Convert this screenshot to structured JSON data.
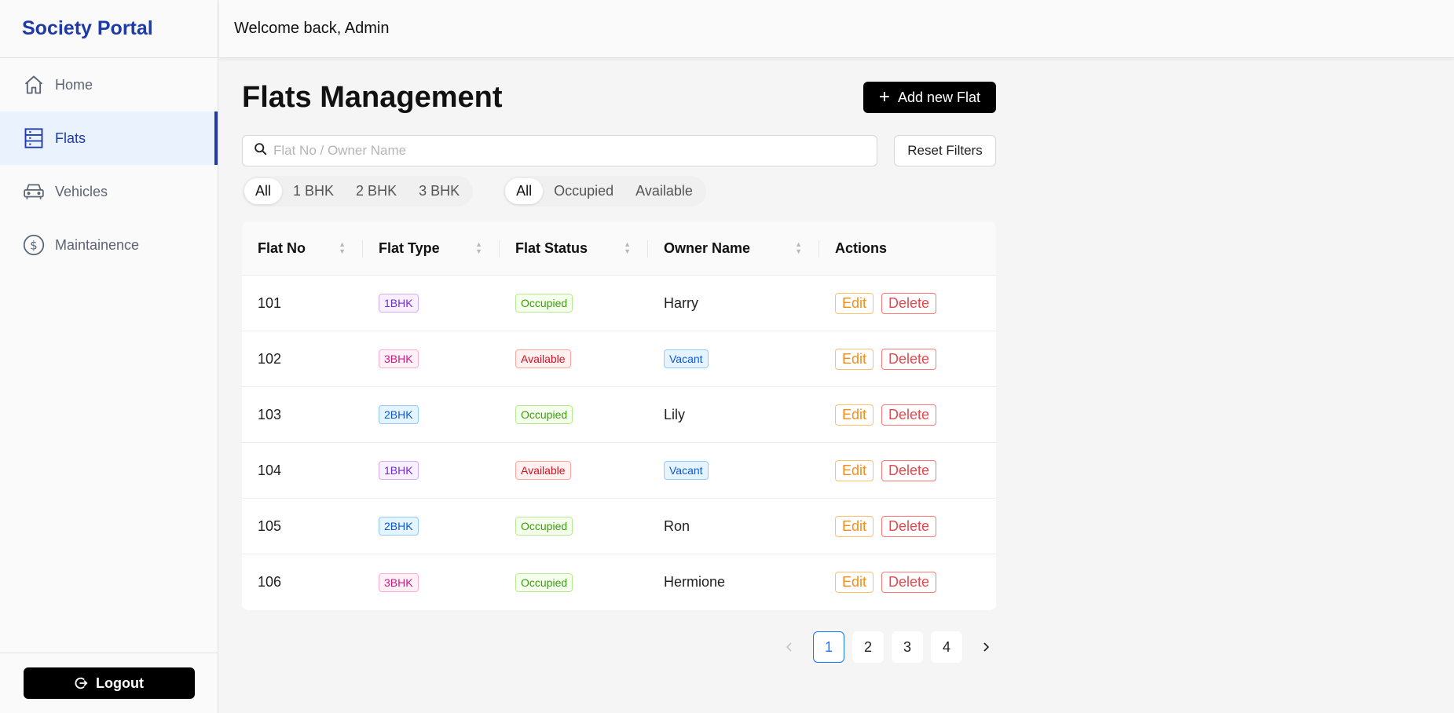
{
  "app": {
    "brand": "Society Portal"
  },
  "header": {
    "welcome": "Welcome back, Admin"
  },
  "sidebar": {
    "items": [
      {
        "label": "Home",
        "icon": "home-icon"
      },
      {
        "label": "Flats",
        "icon": "building-icon",
        "active": true
      },
      {
        "label": "Vehicles",
        "icon": "car-icon"
      },
      {
        "label": "Maintainence",
        "icon": "dollar-icon"
      }
    ],
    "logout_label": "Logout"
  },
  "main": {
    "title": "Flats Management",
    "add_label": "Add new Flat",
    "search_placeholder": "Flat No / Owner Name",
    "reset_label": "Reset Filters",
    "type_filters": [
      "All",
      "1 BHK",
      "2 BHK",
      "3 BHK"
    ],
    "status_filters": [
      "All",
      "Occupied",
      "Available"
    ]
  },
  "table": {
    "columns": [
      "Flat No",
      "Flat Type",
      "Flat Status",
      "Owner Name",
      "Actions"
    ],
    "edit_label": "Edit",
    "delete_label": "Delete",
    "rows": [
      {
        "flat_no": "101",
        "type": "1BHK",
        "status": "Occupied",
        "owner": "Harry"
      },
      {
        "flat_no": "102",
        "type": "3BHK",
        "status": "Available",
        "owner": "Vacant"
      },
      {
        "flat_no": "103",
        "type": "2BHK",
        "status": "Occupied",
        "owner": "Lily"
      },
      {
        "flat_no": "104",
        "type": "1BHK",
        "status": "Available",
        "owner": "Vacant"
      },
      {
        "flat_no": "105",
        "type": "2BHK",
        "status": "Occupied",
        "owner": "Ron"
      },
      {
        "flat_no": "106",
        "type": "3BHK",
        "status": "Occupied",
        "owner": "Hermione"
      }
    ]
  },
  "pagination": {
    "pages": [
      "1",
      "2",
      "3",
      "4"
    ],
    "current": "1"
  },
  "colors": {
    "brand": "#1e3aa8",
    "primary": "#1677ff",
    "edit": "#fa8c16",
    "delete": "#e5484d"
  }
}
